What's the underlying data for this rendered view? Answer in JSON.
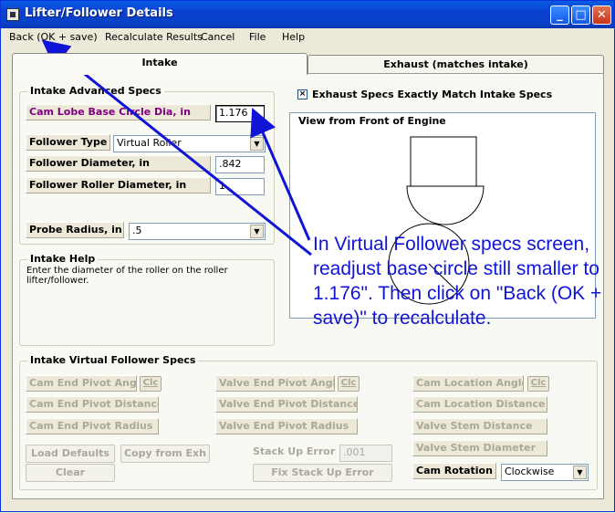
{
  "window": {
    "title": "Lifter/Follower Details"
  },
  "titlebar_buttons": {
    "minimize": "_",
    "maximize": "□",
    "close": "✕"
  },
  "menu": [
    "Back (OK + save)",
    "Recalculate Results",
    "Cancel",
    "File",
    "Help"
  ],
  "tabs": {
    "intake": "Intake",
    "exhaust": "Exhaust (matches intake)"
  },
  "advanced": {
    "title": "Intake Advanced Specs",
    "base_circle_label": "Cam Lobe Base Circle Dia, in",
    "base_circle_value": "1.176",
    "follower_type_label": "Follower Type",
    "follower_type_value": "Virtual Roller",
    "follower_diameter_label": "Follower Diameter, in",
    "follower_diameter_value": ".842",
    "roller_diameter_label": "Follower Roller Diameter, in",
    "roller_diameter_value": "1",
    "probe_radius_label": "Probe Radius, in",
    "probe_radius_value": ".5"
  },
  "help": {
    "title": "Intake Help",
    "text": "Enter the diameter of the roller on the roller lifter/follower."
  },
  "exhaust_match": {
    "checkbox_mark": "×",
    "label": "Exhaust Specs Exactly Match Intake Specs"
  },
  "view": {
    "title": "View from Front of Engine"
  },
  "virtual": {
    "title": "Intake Virtual Follower Specs",
    "cam_end_pivot_angle": "Cam End Pivot Angle",
    "cam_end_pivot_distance": "Cam End Pivot Distance",
    "cam_end_pivot_radius": "Cam End Pivot Radius",
    "valve_end_pivot_angle": "Valve End Pivot Angle",
    "valve_end_pivot_distance": "Valve End Pivot Distance",
    "valve_end_pivot_radius": "Valve End Pivot Radius",
    "cam_location_angle": "Cam Location Angle",
    "cam_location_distance": "Cam Location Distance",
    "valve_stem_distance": "Valve Stem Distance",
    "valve_stem_diameter": "Valve Stem Diameter",
    "clc": "Clc",
    "load_defaults": "Load Defaults",
    "copy_from_exh": "Copy from Exh",
    "clear": "Clear",
    "stack_up_error_label": "Stack Up Error",
    "stack_up_error_value": ".001",
    "fix_stack_up_error": "Fix Stack Up Error",
    "cam_rotation_label": "Cam Rotation",
    "cam_rotation_value": "Clockwise"
  },
  "annotation": {
    "text": "In Virtual Follower specs screen, readjust base circle still smaller to 1.176\". Then click on \"Back (OK + save)\" to recalculate.",
    "color": "#1014d6"
  }
}
